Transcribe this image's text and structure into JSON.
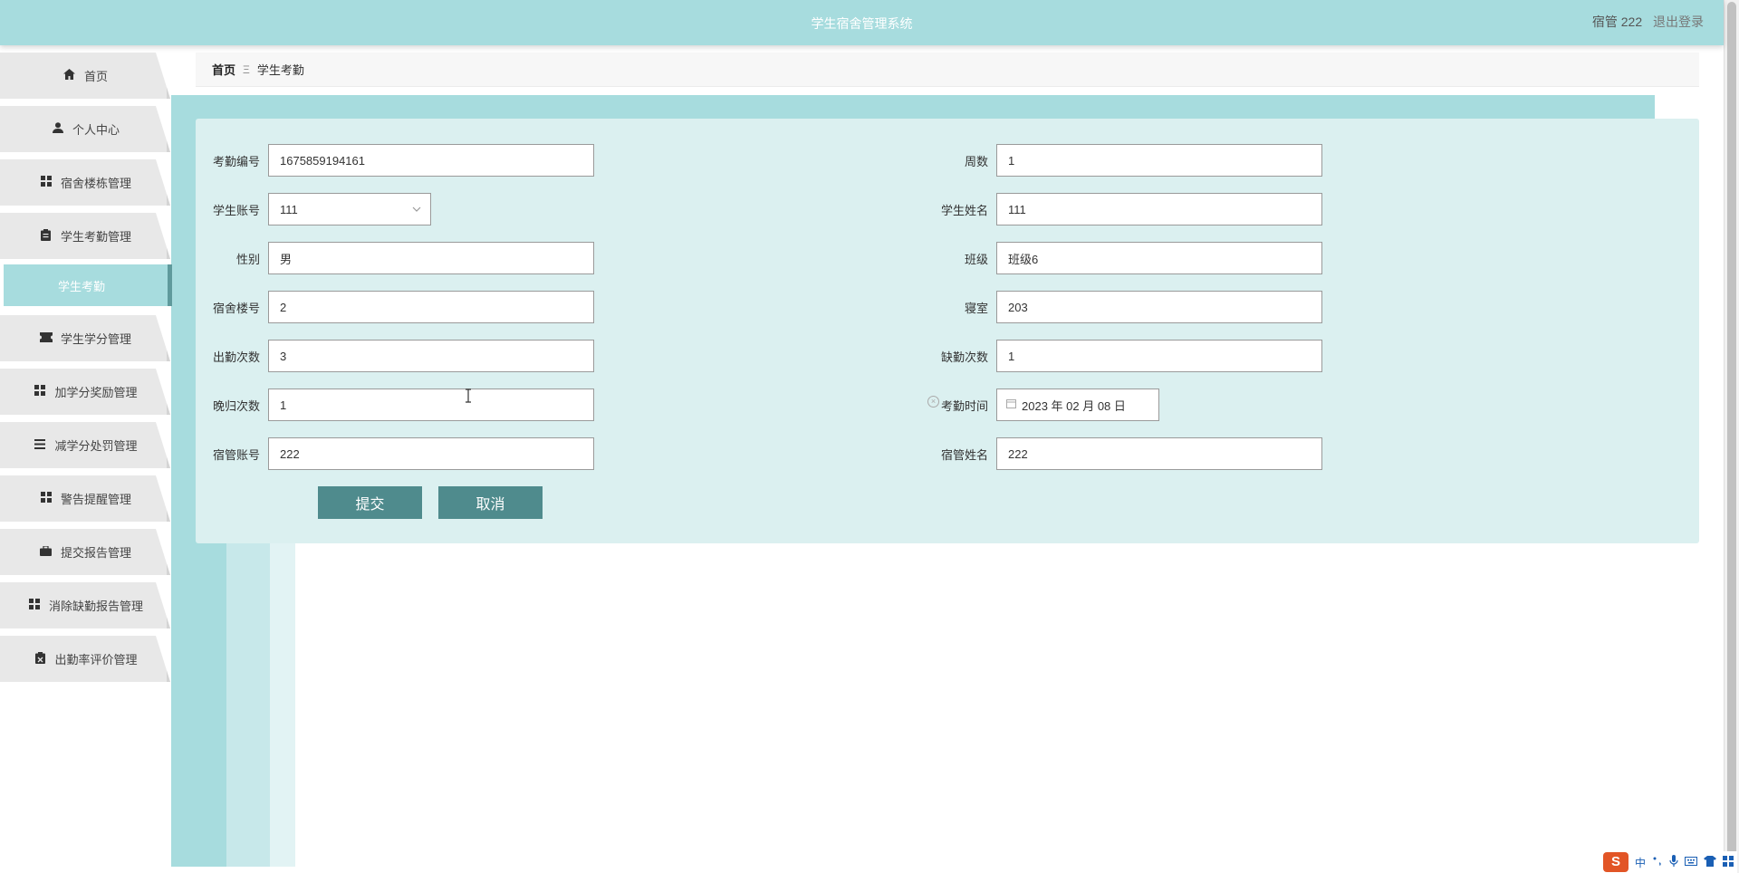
{
  "header": {
    "title": "学生宿舍管理系统",
    "user_role": "宿管 222",
    "logout": "退出登录"
  },
  "sidebar": {
    "items": [
      {
        "label": "首页",
        "icon": "home-icon"
      },
      {
        "label": "个人中心",
        "icon": "user-icon"
      },
      {
        "label": "宿舍楼栋管理",
        "icon": "grid-icon"
      },
      {
        "label": "学生考勤管理",
        "icon": "clipboard-icon"
      },
      {
        "label": "学生学分管理",
        "icon": "ticket-icon"
      },
      {
        "label": "加学分奖励管理",
        "icon": "grid-icon"
      },
      {
        "label": "减学分处罚管理",
        "icon": "list-icon"
      },
      {
        "label": "警告提醒管理",
        "icon": "grid-icon"
      },
      {
        "label": "提交报告管理",
        "icon": "briefcase-icon"
      },
      {
        "label": "消除缺勤报告管理",
        "icon": "grid-icon"
      },
      {
        "label": "出勤率评价管理",
        "icon": "clipboard-x-icon"
      }
    ],
    "active_sub": "学生考勤"
  },
  "breadcrumb": {
    "home": "首页",
    "separator": "Ξ",
    "current": "学生考勤"
  },
  "form": {
    "kqbh": {
      "label": "考勤编号",
      "value": "1675859194161"
    },
    "zhoushu": {
      "label": "周数",
      "value": "1"
    },
    "xszh": {
      "label": "学生账号",
      "value": "111"
    },
    "xsxm": {
      "label": "学生姓名",
      "value": "111"
    },
    "xb": {
      "label": "性别",
      "value": "男"
    },
    "bj": {
      "label": "班级",
      "value": "班级6"
    },
    "ssld": {
      "label": "宿舍楼号",
      "value": "2"
    },
    "qs": {
      "label": "寝室",
      "value": "203"
    },
    "cqcs": {
      "label": "出勤次数",
      "value": "3"
    },
    "qqcs": {
      "label": "缺勤次数",
      "value": "1"
    },
    "wgcs": {
      "label": "晚归次数",
      "value": "1"
    },
    "kqsj": {
      "label": "考勤时间",
      "value": "2023 年 02 月 08 日"
    },
    "sgzh": {
      "label": "宿管账号",
      "value": "222"
    },
    "sgxm": {
      "label": "宿管姓名",
      "value": "222"
    },
    "submit": "提交",
    "cancel": "取消"
  },
  "colors": {
    "accent": "#a7dcde",
    "button": "#4f8b8d",
    "card": "#dbf0f0"
  },
  "ime": {
    "logo": "S",
    "lang": "中"
  }
}
